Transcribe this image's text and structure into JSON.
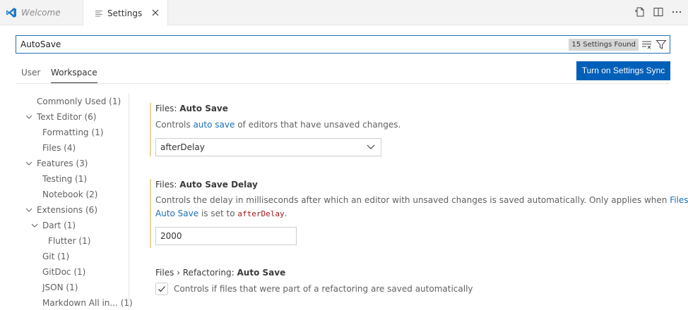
{
  "tabs": {
    "welcome": "Welcome",
    "settings": "Settings"
  },
  "search": {
    "value": "AutoSave",
    "count": "15 Settings Found"
  },
  "scope": {
    "user": "User",
    "workspace": "Workspace",
    "sync_button": "Turn on Settings Sync"
  },
  "toc": [
    {
      "label": "Commonly Used",
      "count": "(1)"
    },
    {
      "label": "Text Editor",
      "count": "(6)"
    },
    {
      "label": "Formatting",
      "count": "(1)"
    },
    {
      "label": "Files",
      "count": "(4)"
    },
    {
      "label": "Features",
      "count": "(3)"
    },
    {
      "label": "Testing",
      "count": "(1)"
    },
    {
      "label": "Notebook",
      "count": "(2)"
    },
    {
      "label": "Extensions",
      "count": "(6)"
    },
    {
      "label": "Dart",
      "count": "(1)"
    },
    {
      "label": "Flutter",
      "count": "(1)"
    },
    {
      "label": "Git",
      "count": "(1)"
    },
    {
      "label": "GitDoc",
      "count": "(1)"
    },
    {
      "label": "JSON",
      "count": "(1)"
    },
    {
      "label": "Markdown All in...",
      "count": "(1)"
    }
  ],
  "settings": {
    "auto_save": {
      "category": "Files: ",
      "name": "Auto Save",
      "desc_before": "Controls ",
      "desc_link": "auto save",
      "desc_after": " of editors that have unsaved changes.",
      "value": "afterDelay"
    },
    "auto_save_delay": {
      "category": "Files: ",
      "name": "Auto Save Delay",
      "desc_line1_before": "Controls the delay in milliseconds after which an editor with unsaved changes is saved automatically. Only applies when ",
      "desc_link1": "Files:",
      "desc_link2": "Auto Save",
      "desc_line2_mid": " is set to ",
      "desc_code": "afterDelay",
      "desc_line2_end": ".",
      "value": "2000"
    },
    "refactoring": {
      "category": "Files › Refactoring: ",
      "name": "Auto Save",
      "desc": "Controls if files that were part of a refactoring are saved automatically",
      "checked": true
    }
  },
  "colors": {
    "accent": "#005fb8",
    "modified_bar": "#e9d39b",
    "link": "#1a6fb8"
  }
}
